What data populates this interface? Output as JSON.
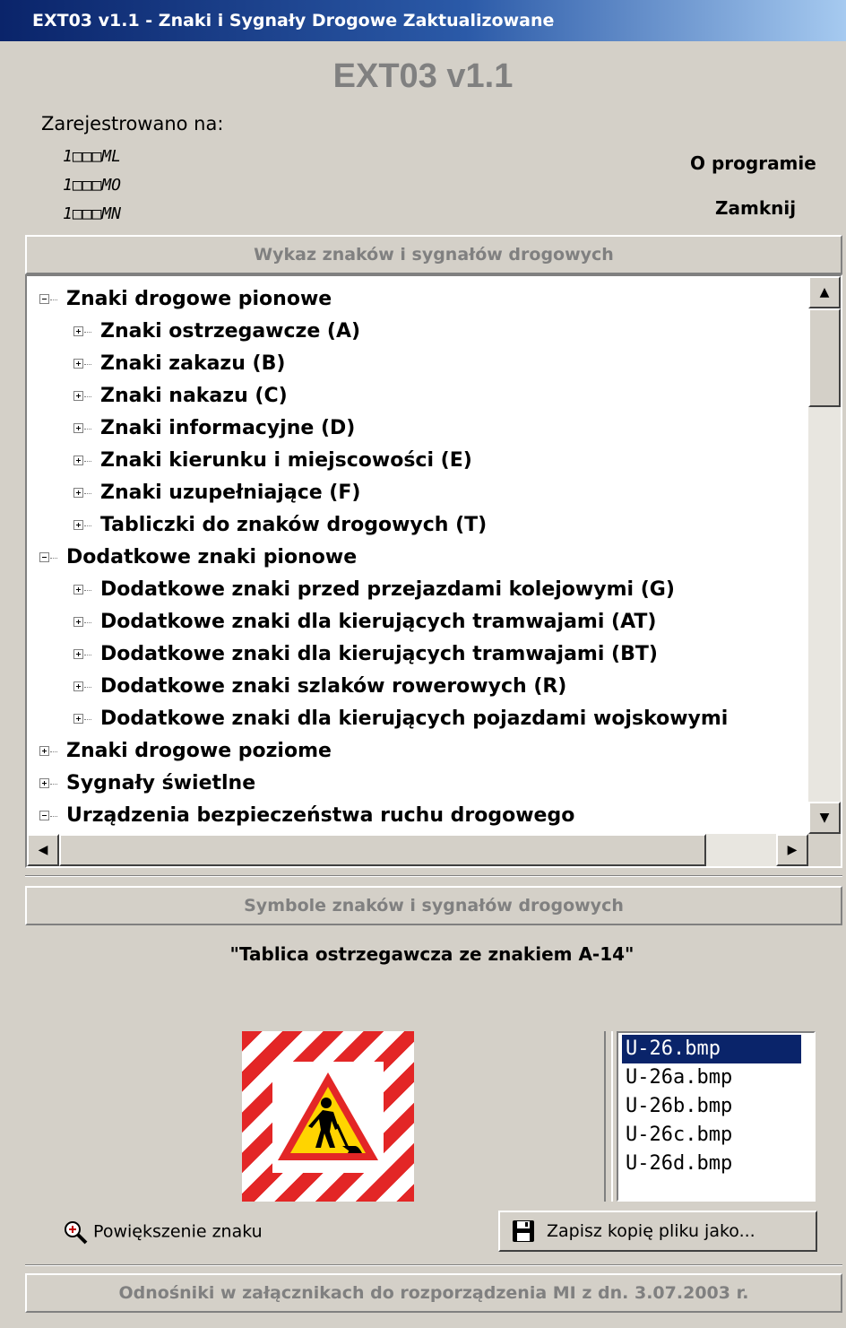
{
  "window": {
    "title": "EXT03 v1.1 - Znaki i Sygnały Drogowe Zaktualizowane"
  },
  "header": {
    "app_title": "EXT03 v1.1",
    "registered_label": "Zarejestrowano na:",
    "registered_to": [
      "1□□□ML",
      "1□□□MO",
      "1□□□MN"
    ],
    "about_label": "O programie",
    "close_label": "Zamknij"
  },
  "tree_section": {
    "title": "Wykaz znaków i sygnałów drogowych",
    "nodes": [
      {
        "label": "Znaki drogowe pionowe",
        "level": 0,
        "expanded": true
      },
      {
        "label": "Znaki ostrzegawcze (A)",
        "level": 1,
        "expanded": false
      },
      {
        "label": "Znaki zakazu (B)",
        "level": 1,
        "expanded": false
      },
      {
        "label": "Znaki nakazu (C)",
        "level": 1,
        "expanded": false
      },
      {
        "label": "Znaki informacyjne (D)",
        "level": 1,
        "expanded": false
      },
      {
        "label": "Znaki kierunku i miejscowości (E)",
        "level": 1,
        "expanded": false
      },
      {
        "label": "Znaki uzupełniające (F)",
        "level": 1,
        "expanded": false
      },
      {
        "label": "Tabliczki do znaków drogowych (T)",
        "level": 1,
        "expanded": false
      },
      {
        "label": "Dodatkowe znaki pionowe",
        "level": 0,
        "expanded": true
      },
      {
        "label": "Dodatkowe znaki przed przejazdami kolejowymi (G)",
        "level": 1,
        "expanded": false
      },
      {
        "label": "Dodatkowe znaki dla kierujących tramwajami (AT)",
        "level": 1,
        "expanded": false
      },
      {
        "label": "Dodatkowe znaki dla kierujących tramwajami (BT)",
        "level": 1,
        "expanded": false
      },
      {
        "label": "Dodatkowe znaki szlaków rowerowych (R)",
        "level": 1,
        "expanded": false
      },
      {
        "label": "Dodatkowe znaki dla kierujących pojazdami wojskowymi",
        "level": 1,
        "expanded": false
      },
      {
        "label": "Znaki drogowe poziome",
        "level": 0,
        "expanded": false
      },
      {
        "label": "Sygnały świetlne",
        "level": 0,
        "expanded": false
      },
      {
        "label": "Urządzenia bezpieczeństwa ruchu drogowego",
        "level": 0,
        "expanded": true
      }
    ]
  },
  "symbol_section": {
    "title": "Symbole znaków i sygnałów drogowych",
    "caption": "\"Tablica ostrzegawcza ze znakiem A-14\"",
    "files": [
      "U-26.bmp",
      "U-26a.bmp",
      "U-26b.bmp",
      "U-26c.bmp",
      "U-26d.bmp"
    ],
    "selected_file": "U-26.bmp",
    "zoom_label": "Powiększenie znaku",
    "save_label": "Zapisz kopię pliku jako..."
  },
  "footer": {
    "label": "Odnośniki w załącznikach do rozporządzenia MI z dn. 3.07.2003 r."
  },
  "colors": {
    "face": "#d4d0c8",
    "selection": "#0a246a",
    "stripe": "#e32626",
    "warning_yellow": "#ffd400"
  }
}
